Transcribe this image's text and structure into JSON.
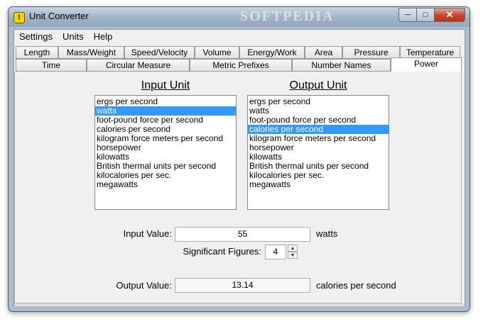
{
  "window": {
    "title": "Unit Converter",
    "app_icon_glyph": "!",
    "watermark": "SOFTPEDIA",
    "controls": {
      "minimize": "─",
      "maximize": "□",
      "close": "✕"
    }
  },
  "menu": [
    "Settings",
    "Units",
    "Help"
  ],
  "tabs": {
    "row1": [
      "Length",
      "Mass/Weight",
      "Speed/Velocity",
      "Volume",
      "Energy/Work",
      "Area",
      "Pressure",
      "Temperature"
    ],
    "row2": [
      "Time",
      "Circular Measure",
      "Metric Prefixes",
      "Number Names",
      "Power"
    ],
    "selected": "Power"
  },
  "input_unit": {
    "heading": "Input Unit",
    "items": [
      "ergs per second",
      "watts",
      "foot-pound force per second",
      "calories per second",
      "kilogram force meters per second",
      "horsepower",
      "kilowatts",
      "British thermal units per second",
      "kilocalories per sec.",
      "megawatts"
    ],
    "selected": "watts"
  },
  "output_unit": {
    "heading": "Output Unit",
    "items": [
      "ergs per second",
      "watts",
      "foot-pound force per second",
      "calories per second",
      "kilogram force meters per second",
      "horsepower",
      "kilowatts",
      "British thermal units per second",
      "kilocalories per sec.",
      "megawatts"
    ],
    "selected": "calories per second"
  },
  "input_value": {
    "label": "Input Value:",
    "value": "55",
    "unit": "watts"
  },
  "significant_figures": {
    "label": "Significant Figures:",
    "value": "4",
    "up": "▲",
    "down": "▼"
  },
  "output_value": {
    "label": "Output Value:",
    "value": "13.14",
    "unit": "calories per second"
  },
  "colors": {
    "selection": "#3399ff",
    "background": "#f0f0f0"
  }
}
